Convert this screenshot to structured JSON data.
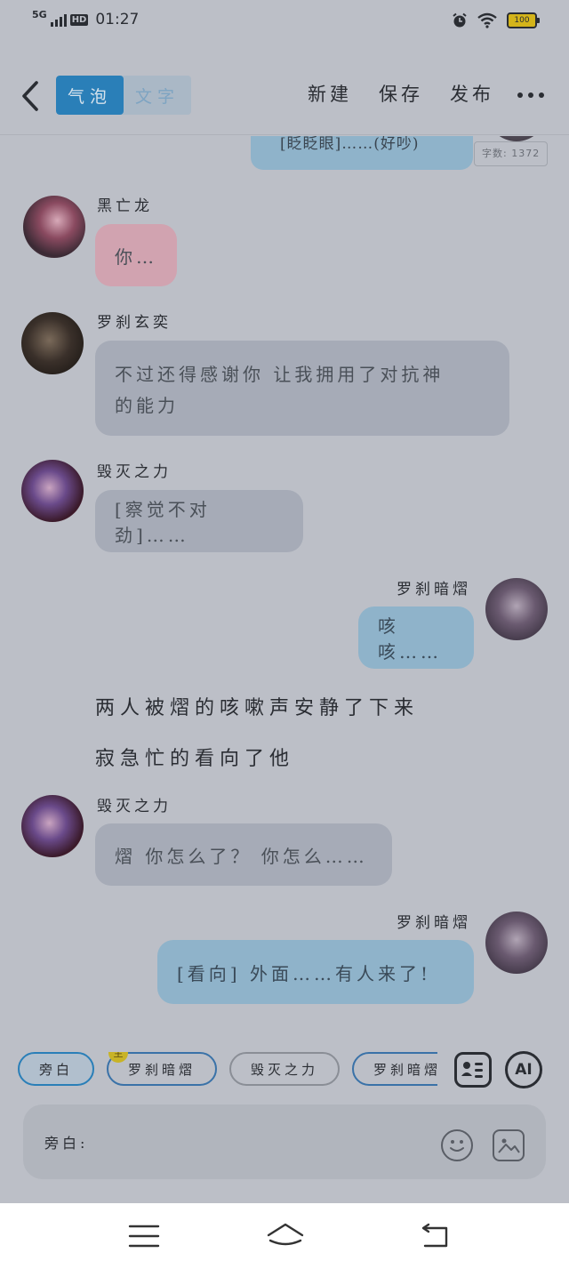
{
  "status_bar": {
    "network": "5G",
    "hd": "HD",
    "time": "01:27",
    "battery": "100"
  },
  "header": {
    "tabs": [
      {
        "label": "气泡",
        "active": true
      },
      {
        "label": "文字",
        "active": false
      }
    ],
    "actions": [
      "新建",
      "保存",
      "发布"
    ]
  },
  "chat": {
    "partial_top_message": "[眨眨眼]……(好吵)",
    "word_count": "字数: 1372",
    "messages": [
      {
        "speaker": "黑亡龙",
        "text": "你…",
        "side": "left",
        "color": "pink"
      },
      {
        "speaker": "罗刹玄奕",
        "text_lines": [
          "不过还得感谢你 让我拥用了对抗神",
          "的能力"
        ],
        "side": "left",
        "color": "gray"
      },
      {
        "speaker": "毁灭之力",
        "text": "[察觉不对劲]……",
        "side": "left",
        "color": "gray"
      },
      {
        "speaker": "罗刹暗熠",
        "text": "咳咳……",
        "side": "right",
        "color": "blue"
      },
      {
        "narration": "两人被熠的咳嗽声安静了下来"
      },
      {
        "narration": "寂急忙的看向了他"
      },
      {
        "speaker": "毁灭之力",
        "text": "熠 你怎么了？ 你怎么……",
        "side": "left",
        "color": "gray"
      },
      {
        "speaker": "罗刹暗熠",
        "text": "[看向] 外面……有人来了!",
        "side": "right",
        "color": "blue"
      }
    ]
  },
  "toolbar": {
    "chips": [
      {
        "label": "旁白",
        "active": true
      },
      {
        "label": "罗刹暗熠",
        "badge": "主"
      },
      {
        "label": "毁灭之力"
      },
      {
        "label": "罗刹暗熠（小"
      }
    ],
    "ai_label": "AI",
    "input_label": "旁白:"
  },
  "colors": {
    "background": "#bcbfc7",
    "accent": "#2a7fb8",
    "bubble_blue": "#8fb3ca",
    "bubble_gray": "#a6abb7",
    "bubble_pink": "#d1a3b0",
    "badge": "#c8b326"
  },
  "icons": {
    "back": "chevron-left-icon",
    "more": "more-dots-icon",
    "card": "character-card-icon",
    "emoji": "smiley-icon",
    "image": "image-icon",
    "nav": [
      "menu-icon",
      "home-icon",
      "back-nav-icon"
    ]
  }
}
